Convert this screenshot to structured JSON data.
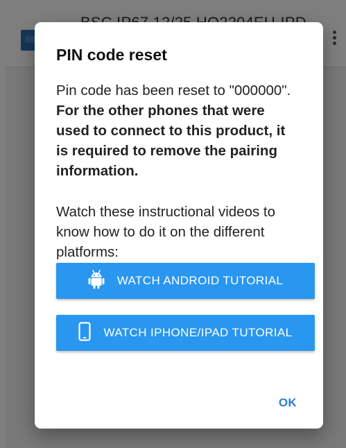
{
  "app": {
    "title": "BSC IP67 12/25 HQ2204EU-IPD"
  },
  "dialog": {
    "title": "PIN code reset",
    "reset_text": "Pin code has been reset to \"000000\".",
    "warning_text": "For the other phones that were used to connect to this product, it is required to remove the pairing information.",
    "instructions_text": "Watch these instructional videos to know how to do it on the different platforms:",
    "android_button_label": "WATCH ANDROID TUTORIAL",
    "android_button_icon": "android-icon",
    "iphone_button_label": "WATCH IPHONE/IPAD TUTORIAL",
    "iphone_button_icon": "smartphone-icon",
    "ok_label": "OK"
  },
  "colors": {
    "button_background": "#2996ef",
    "ok_text": "#2a7fd0",
    "scrim": "rgba(0,0,0,0.50)"
  }
}
